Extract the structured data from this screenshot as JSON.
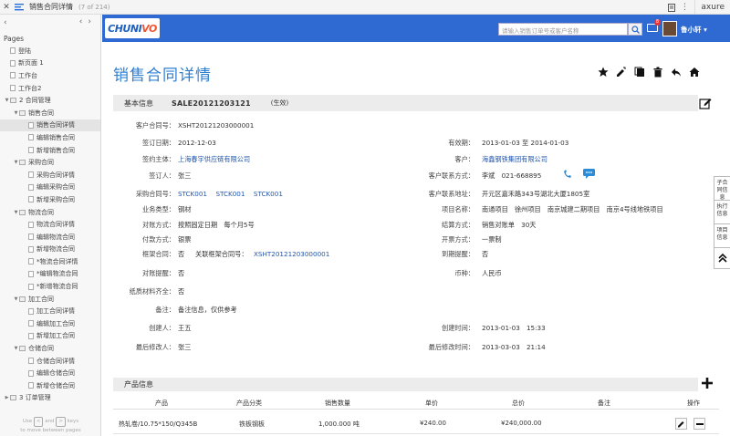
{
  "axure": {
    "page_title": "销售合同详情",
    "page_count": "(7 of 214)",
    "brand": "axure"
  },
  "sidebar": {
    "title": "Pages",
    "items": [
      {
        "label": "登陆",
        "level": 1,
        "type": "page"
      },
      {
        "label": "新页面 1",
        "level": 1,
        "type": "page"
      },
      {
        "label": "工作台",
        "level": 1,
        "type": "page"
      },
      {
        "label": "工作台2",
        "level": 1,
        "type": "page"
      },
      {
        "label": "2 合同管理",
        "level": 1,
        "type": "folder",
        "open": true
      },
      {
        "label": "销售合同",
        "level": 2,
        "type": "folder",
        "open": true
      },
      {
        "label": "销售合同详情",
        "level": 3,
        "type": "page",
        "selected": true
      },
      {
        "label": "编辑销售合同",
        "level": 3,
        "type": "page"
      },
      {
        "label": "新增销售合同",
        "level": 3,
        "type": "page"
      },
      {
        "label": "采购合同",
        "level": 2,
        "type": "folder",
        "open": true
      },
      {
        "label": "采购合同详情",
        "level": 3,
        "type": "page"
      },
      {
        "label": "编辑采购合同",
        "level": 3,
        "type": "page"
      },
      {
        "label": "新增采购合同",
        "level": 3,
        "type": "page"
      },
      {
        "label": "物流合同",
        "level": 2,
        "type": "folder",
        "open": true
      },
      {
        "label": "物流合同详情",
        "level": 3,
        "type": "page"
      },
      {
        "label": "编辑物流合同",
        "level": 3,
        "type": "page"
      },
      {
        "label": "新增物流合同",
        "level": 3,
        "type": "page"
      },
      {
        "label": "*物流合同详情",
        "level": 3,
        "type": "page"
      },
      {
        "label": "*编辑物流合同",
        "level": 3,
        "type": "page"
      },
      {
        "label": "*新增物流合同",
        "level": 3,
        "type": "page"
      },
      {
        "label": "加工合同",
        "level": 2,
        "type": "folder",
        "open": true
      },
      {
        "label": "加工合同详情",
        "level": 3,
        "type": "page"
      },
      {
        "label": "编辑加工合同",
        "level": 3,
        "type": "page"
      },
      {
        "label": "新增加工合同",
        "level": 3,
        "type": "page"
      },
      {
        "label": "仓储合同",
        "level": 2,
        "type": "folder",
        "open": true
      },
      {
        "label": "仓储合同详情",
        "level": 3,
        "type": "page"
      },
      {
        "label": "编辑仓储合同",
        "level": 3,
        "type": "page"
      },
      {
        "label": "新增仓储合同",
        "level": 3,
        "type": "page"
      },
      {
        "label": "3 订单管理",
        "level": 1,
        "type": "folder",
        "open": false
      }
    ],
    "hint_line1_a": "Use",
    "hint_key1": "<",
    "hint_and": "and",
    "hint_key2": ">",
    "hint_keys": "keys",
    "hint_line2": "to move between pages"
  },
  "header": {
    "brand_a": "CHUNI",
    "brand_b": "VO",
    "search_placeholder": "请输入销售订单号或客户名称",
    "mail_badge": "8",
    "username": "鲁小轩 ▾"
  },
  "page": {
    "title": "销售合同详情",
    "section1_title": "基本信息",
    "contract_code": "SALE20121203121",
    "status": "(生效)",
    "section2_title": "产品信息"
  },
  "fields": {
    "customer_contract_no_label": "客户合同号：",
    "customer_contract_no": "XSHT20121203000001",
    "sign_date_label": "签订日期：",
    "sign_date": "2012-12-03",
    "valid_period_label": "有效期：",
    "valid_period": "2013-01-03 至 2014-01-03",
    "sign_subject_label": "签约主体：",
    "sign_subject": "上海春宇供应链有限公司",
    "customer_label": "客户：",
    "customer": "海鑫钢铁集团有限公司",
    "signer_label": "签订人：",
    "signer": "张三",
    "contact_label": "客户联系方式：",
    "contact": "李斌　021-668895",
    "purchase_no_label": "采购合同号：",
    "purchase_no": "STCK001　 STCK001　 STCK001",
    "customer_addr_label": "客户联系地址：",
    "customer_addr": "开元区嘉禾路343号湖北大厦1805室",
    "biz_type_label": "业务类型：",
    "biz_type": "钢材",
    "project_label": "项目名称：",
    "project": "南通项目　徐州项目　南京城建二期项目　南京4号线地铁项目",
    "recon_label": "对账方式：",
    "recon": "按照固定日期　每个月5号",
    "settle_label": "结算方式：",
    "settle": "销售对账单　30天",
    "pay_label": "付款方式：",
    "pay": "银票",
    "invoice_label": "开票方式：",
    "invoice": "一票制",
    "frame_label": "框架合同：",
    "frame": "否",
    "frame_link_label": "关联框架合同号：",
    "frame_link": "XSHT20121203000001",
    "expire_remind_label": "到期提醒：",
    "expire_remind": "否",
    "recon_remind_label": "对账提醒：",
    "recon_remind": "否",
    "currency_label": "币种：",
    "currency": "人民币",
    "paper_label": "纸质材料齐全：",
    "paper": "否",
    "remark_label": "备注：",
    "remark": "备注信息，仅供参考",
    "creator_label": "创建人：",
    "creator": "王五",
    "create_time_label": "创建时间：",
    "create_time": "2013-01-03　15:33",
    "modifier_label": "最后修改人：",
    "modifier": "张三",
    "modify_time_label": "最后修改时间：",
    "modify_time": "2013-03-03　21:14"
  },
  "right_tabs": [
    "子合同信息",
    "执行信息",
    "项目信息"
  ],
  "products": {
    "columns": [
      "产品",
      "产品分类",
      "销售数量",
      "单价",
      "总价",
      "备注",
      "操作"
    ],
    "rows": [
      {
        "product": "热轧卷/10.75*150/Q345B",
        "category": "铁板钢板",
        "qty": "1,000.000 吨",
        "price": "¥240.00",
        "total": "¥240,000.00",
        "remark": ""
      }
    ]
  }
}
